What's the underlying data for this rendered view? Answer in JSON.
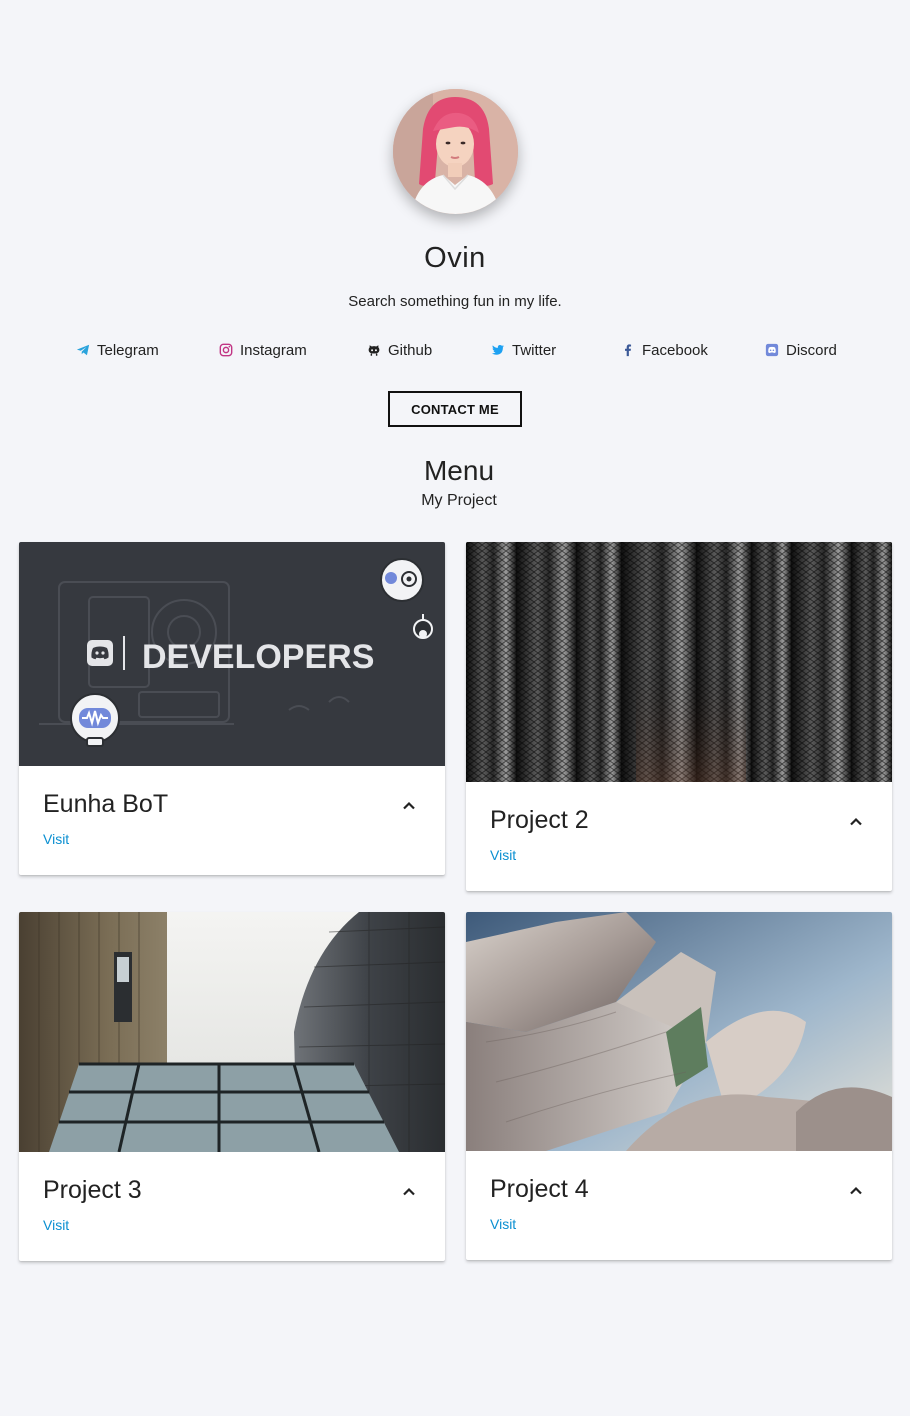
{
  "profile": {
    "name": "Ovin",
    "tagline": "Search something fun in my life."
  },
  "socials": [
    {
      "label": "Telegram",
      "icon": "telegram-icon",
      "color": "#2aa3dc"
    },
    {
      "label": "Instagram",
      "icon": "instagram-icon",
      "color": "#c13584"
    },
    {
      "label": "Github",
      "icon": "github-icon",
      "color": "#222222"
    },
    {
      "label": "Twitter",
      "icon": "twitter-icon",
      "color": "#1da1f2"
    },
    {
      "label": "Facebook",
      "icon": "facebook-icon",
      "color": "#3b5998"
    },
    {
      "label": "Discord",
      "icon": "discord-icon",
      "color": "#7289da"
    }
  ],
  "contact_button": "CONTACT ME",
  "menu": {
    "title": "Menu",
    "subtitle": "My Project"
  },
  "projects": [
    {
      "title": "Eunha BoT",
      "link": "Visit",
      "banner_text": "DEVELOPERS"
    },
    {
      "title": "Project 2",
      "link": "Visit"
    },
    {
      "title": "Project 3",
      "link": "Visit"
    },
    {
      "title": "Project 4",
      "link": "Visit"
    }
  ],
  "colors": {
    "background": "#f4f5f9",
    "link": "#0a8fd1",
    "discord_dark": "#36393f"
  }
}
